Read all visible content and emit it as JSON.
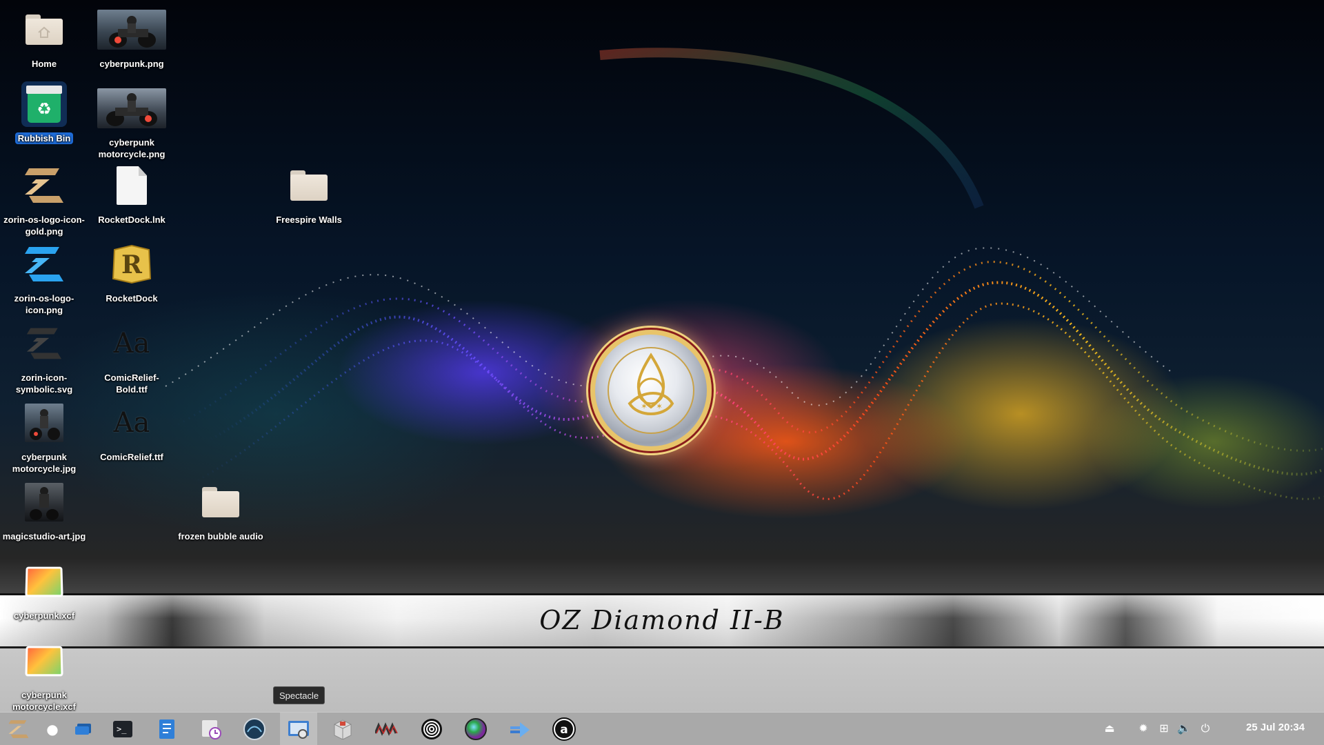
{
  "wallpaper": {
    "banner_text": "OZ Diamond II-B"
  },
  "desktop_icons": [
    {
      "label": "Home",
      "type": "folder-home"
    },
    {
      "label": "cyberpunk.png",
      "type": "image"
    },
    {
      "label": "Rubbish Bin",
      "type": "trash",
      "selected": true
    },
    {
      "label": "cyberpunk motorcycle.png",
      "type": "image"
    },
    {
      "label": "zorin-os-logo-icon-gold.png",
      "type": "image"
    },
    {
      "label": "RocketDock.lnk",
      "type": "file"
    },
    {
      "label": "Freespire Walls",
      "type": "folder"
    },
    {
      "label": "zorin-os-logo-icon.png",
      "type": "image"
    },
    {
      "label": "RocketDock",
      "type": "app"
    },
    {
      "label": "zorin-icon-symbolic.svg",
      "type": "image"
    },
    {
      "label": "ComicRelief-Bold.ttf",
      "type": "font"
    },
    {
      "label": "cyberpunk motorcycle.jpg",
      "type": "image"
    },
    {
      "label": "ComicRelief.ttf",
      "type": "font"
    },
    {
      "label": "magicstudio-art.jpg",
      "type": "image"
    },
    {
      "label": "frozen bubble audio",
      "type": "folder"
    },
    {
      "label": "cyberpunk.xcf",
      "type": "xcf"
    },
    {
      "label": "cyberpunk motorcycle.xcf",
      "type": "xcf"
    }
  ],
  "tooltip": {
    "text": "Spectacle"
  },
  "taskbar": {
    "apps": [
      {
        "icon": "zorin-menu-icon",
        "label": "Zorin Menu"
      },
      {
        "icon": "apple-icon",
        "label": "Apple"
      },
      {
        "icon": "show-desktop-icon",
        "label": "Show Desktop"
      },
      {
        "icon": "terminal-icon",
        "label": "Terminal"
      },
      {
        "icon": "text-editor-icon",
        "label": "Text Editor"
      },
      {
        "icon": "schedule-icon",
        "label": "Schedule"
      },
      {
        "icon": "screensaver-icon",
        "label": "Screensaver"
      },
      {
        "icon": "spectacle-icon",
        "label": "Spectacle"
      },
      {
        "icon": "package-icon",
        "label": "Package"
      },
      {
        "icon": "audio-visualizer-icon",
        "label": "Visualizer"
      },
      {
        "icon": "spiral-icon",
        "label": "Spiral"
      },
      {
        "icon": "color-sphere-icon",
        "label": "Color"
      },
      {
        "icon": "arrow-app-icon",
        "label": "Arrow"
      },
      {
        "icon": "amazon-icon",
        "label": "Amazon"
      }
    ],
    "tray": [
      {
        "icon": "eject-icon",
        "glyph": "⏏"
      },
      {
        "icon": "settings-icon",
        "glyph": "✹"
      },
      {
        "icon": "network-icon",
        "glyph": "⊞"
      },
      {
        "icon": "volume-icon",
        "glyph": "🔈"
      },
      {
        "icon": "power-icon",
        "glyph": "⏻"
      }
    ],
    "clock": "25 Jul 20:34"
  }
}
